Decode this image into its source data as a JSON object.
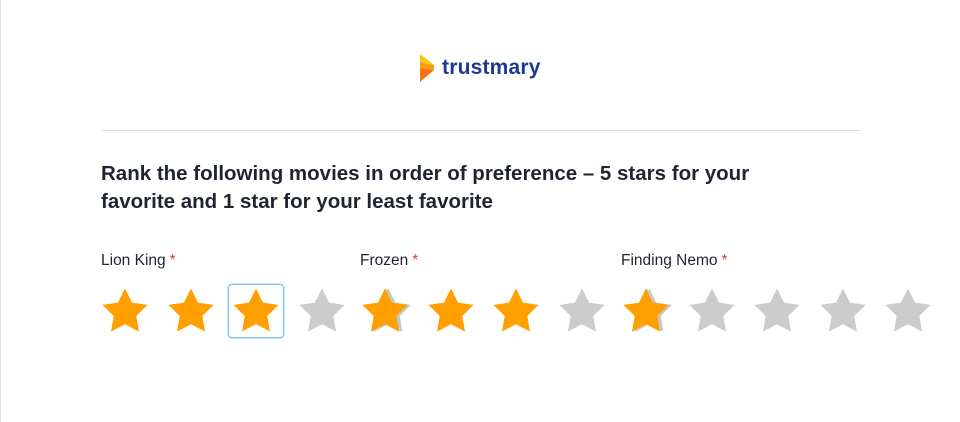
{
  "logo": {
    "text": "trustmary"
  },
  "question": "Rank the following movies in order of preference – 5 stars for your favorite and 1 star for your least favorite",
  "colors": {
    "star_filled": "#ffa000",
    "star_empty": "#cccccc",
    "brand": "#1e3a8a",
    "required": "#e53935",
    "focus": "#7cc4f0"
  },
  "items": [
    {
      "label": "Lion King",
      "required_mark": "*",
      "rating": 3,
      "max": 5
    },
    {
      "label": "Frozen",
      "required_mark": "*",
      "rating": 3,
      "max": 5
    },
    {
      "label": "Finding Nemo",
      "required_mark": "*",
      "rating": 1,
      "max": 5
    }
  ]
}
